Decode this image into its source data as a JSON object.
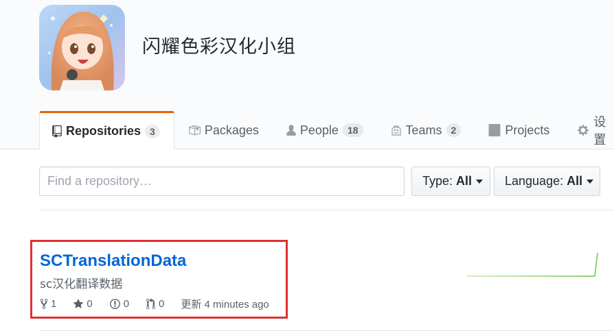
{
  "org": {
    "name": "闪耀色彩汉化小组"
  },
  "tabs": [
    {
      "label": "Repositories",
      "count": "3",
      "icon": "repo-icon"
    },
    {
      "label": "Packages",
      "icon": "package-icon"
    },
    {
      "label": "People",
      "count": "18",
      "icon": "person-icon"
    },
    {
      "label": "Teams",
      "count": "2",
      "icon": "people-icon"
    },
    {
      "label": "Projects",
      "icon": "project-icon"
    },
    {
      "label": "设置",
      "icon": "gear-icon"
    }
  ],
  "filters": {
    "search_placeholder": "Find a repository…",
    "type_label": "Type:",
    "type_value": "All",
    "language_label": "Language:",
    "language_value": "All"
  },
  "repos": [
    {
      "name": "SCTranslationData",
      "description": "sc汉化翻译数据",
      "forks": "1",
      "stars": "0",
      "issues": "0",
      "pull_requests": "0",
      "updated": "更新 4 minutes ago"
    }
  ],
  "colors": {
    "accent_tab": "#e36209",
    "link": "#0366d6",
    "highlight_box": "#e03030",
    "sparkline": "#9cd17e"
  }
}
